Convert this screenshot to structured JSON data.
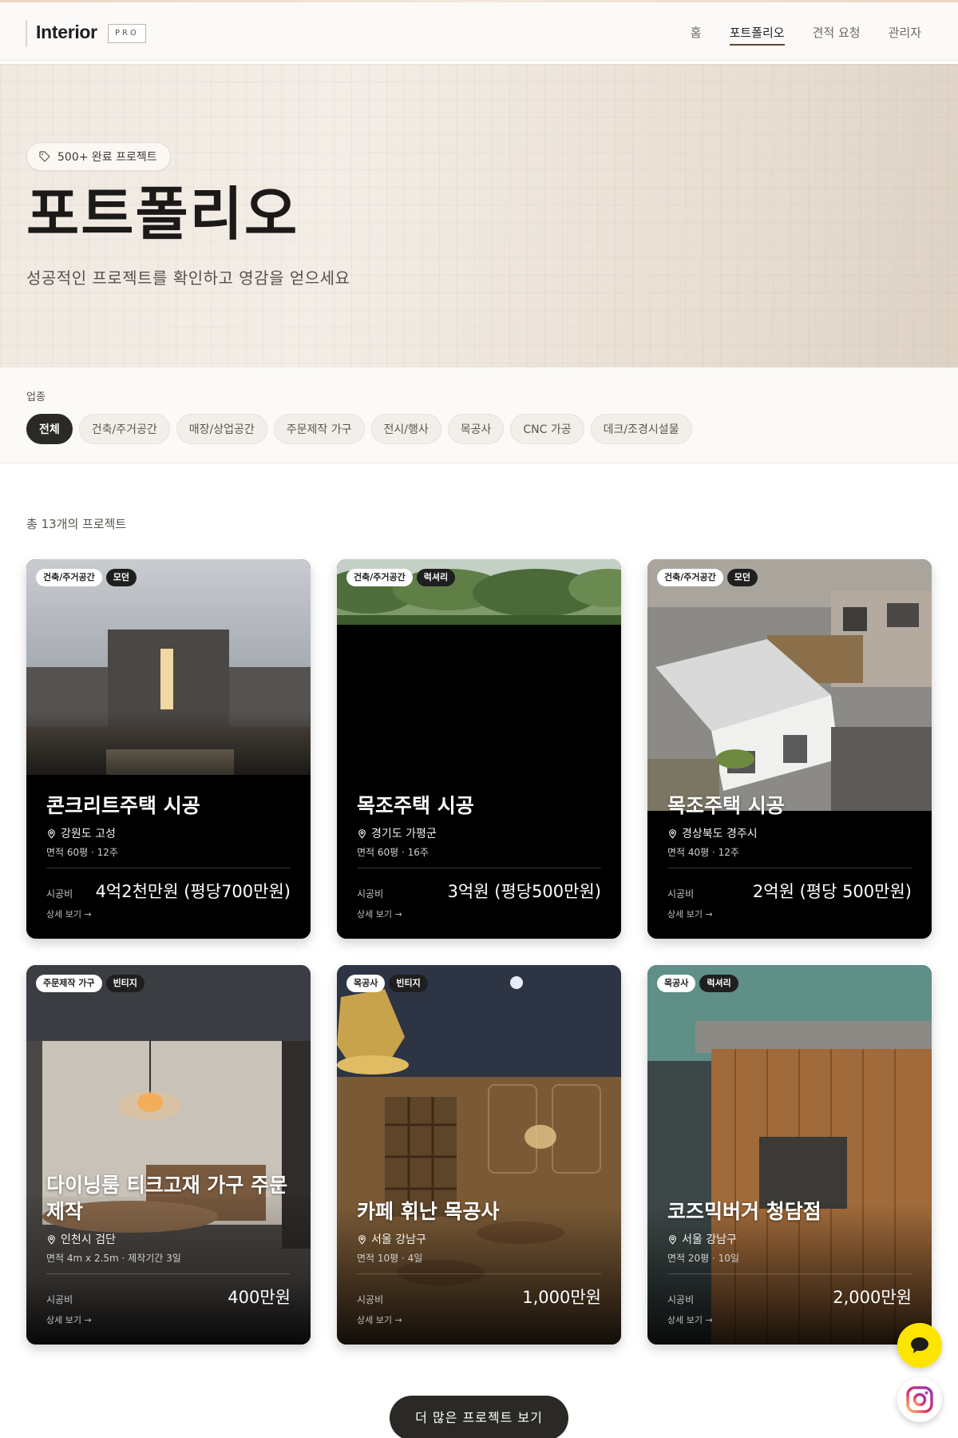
{
  "header": {
    "logo": "Interior",
    "logo_badge": "PRO",
    "nav": [
      {
        "label": "홈"
      },
      {
        "label": "포트폴리오",
        "active": true
      },
      {
        "label": "견적 요청"
      },
      {
        "label": "관리자"
      }
    ]
  },
  "hero": {
    "pill": "500+ 완료 프로젝트",
    "title": "포트폴리오",
    "subtitle": "성공적인 프로젝트를 확인하고 영감을 얻으세요"
  },
  "filter": {
    "label": "업종",
    "chips": [
      "전체",
      "건축/주거공간",
      "매장/상업공간",
      "주문제작 가구",
      "전시/행사",
      "목공사",
      "CNC 가공",
      "데크/조경시설물"
    ],
    "active": "전체"
  },
  "count_text": "총 13개의 프로젝트",
  "cards": [
    {
      "category": "건축/주거공간",
      "style": "모던",
      "title": "콘크리트주택 시공",
      "location": "강원도 고성",
      "meta": "면적 60평 · 12주",
      "cost_label": "시공비",
      "cost": "4억2천만원 (평당700만원)",
      "detail": "상세 보기 →"
    },
    {
      "category": "건축/주거공간",
      "style": "럭셔리",
      "title": "목조주택 시공",
      "location": "경기도 가평군",
      "meta": "면적 60평 · 16주",
      "cost_label": "시공비",
      "cost": "3억원 (평당500만원)",
      "detail": "상세 보기 →"
    },
    {
      "category": "건축/주거공간",
      "style": "모던",
      "title": "목조주택 시공",
      "location": "경상북도 경주시",
      "meta": "면적 40평 · 12주",
      "cost_label": "시공비",
      "cost": "2억원 (평당 500만원)",
      "detail": "상세 보기 →"
    },
    {
      "category": "주문제작 가구",
      "style": "빈티지",
      "title": "다이닝룸 티크고재 가구 주문제작",
      "location": "인천시 검단",
      "meta": "면적 4m x 2.5m · 제작기간 3일",
      "cost_label": "시공비",
      "cost": "400만원",
      "detail": "상세 보기 →"
    },
    {
      "category": "목공사",
      "style": "빈티지",
      "title": "카페 휘난 목공사",
      "location": "서울 강남구",
      "meta": "면적 10평 · 4일",
      "cost_label": "시공비",
      "cost": "1,000만원",
      "detail": "상세 보기 →"
    },
    {
      "category": "목공사",
      "style": "럭셔리",
      "title": "코즈믹버거 청담점",
      "location": "서울 강남구",
      "meta": "면적 20평 · 10일",
      "cost_label": "시공비",
      "cost": "2,000만원",
      "detail": "상세 보기 →"
    }
  ],
  "more_button": "더 많은 프로젝트 보기",
  "icons": {
    "tag": "tag-icon",
    "pin": "map-pin-icon",
    "chat": "chat-icon",
    "instagram": "instagram-icon"
  },
  "colors": {
    "accent_dark": "#2b2926",
    "chat_yellow": "#fee500"
  }
}
